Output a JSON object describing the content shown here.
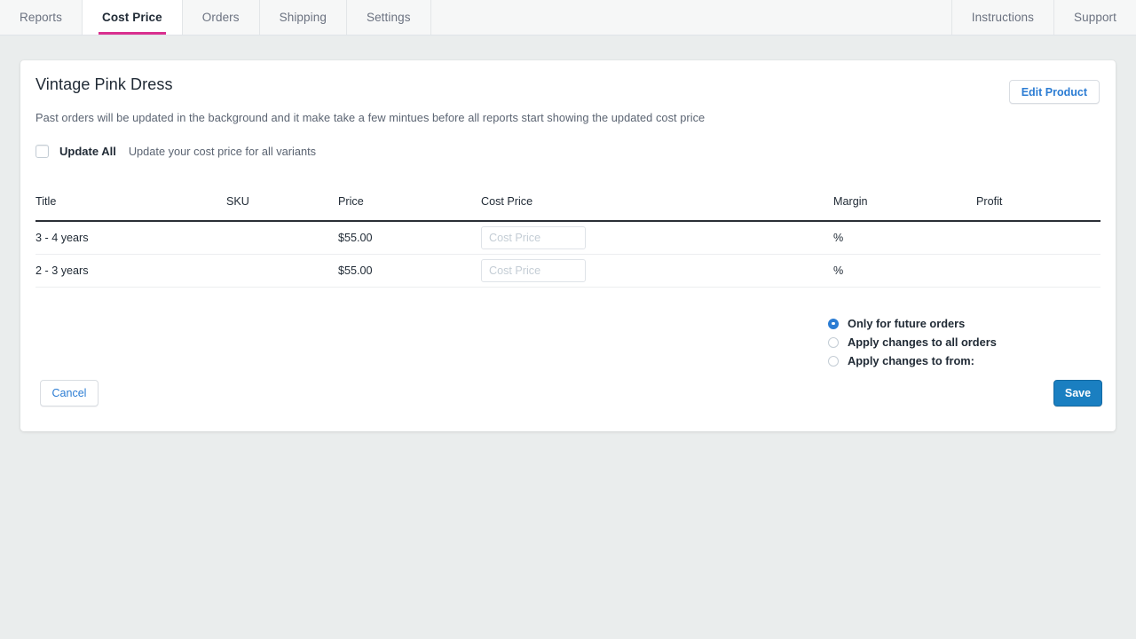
{
  "nav": {
    "left_tabs": [
      {
        "label": "Reports",
        "active": false
      },
      {
        "label": "Cost Price",
        "active": true
      },
      {
        "label": "Orders",
        "active": false
      },
      {
        "label": "Shipping",
        "active": false
      },
      {
        "label": "Settings",
        "active": false
      }
    ],
    "right_tabs": [
      {
        "label": "Instructions"
      },
      {
        "label": "Support"
      }
    ],
    "active_underline_color": "#d9308f"
  },
  "card": {
    "product_title": "Vintage Pink Dress",
    "edit_product_label": "Edit Product",
    "description": "Past orders will be updated in the background and it make take a few mintues before all reports start showing the updated cost price",
    "update_all": {
      "label": "Update All",
      "description": "Update your cost price for all variants",
      "checked": false
    },
    "table": {
      "columns": [
        "Title",
        "SKU",
        "Price",
        "Cost Price",
        "Margin",
        "Profit"
      ],
      "rows": [
        {
          "title": "3 - 4 years",
          "sku": "",
          "price": "$55.00",
          "cost_price_value": "",
          "cost_price_placeholder": "Cost Price",
          "margin": "%",
          "profit": ""
        },
        {
          "title": "2 - 3 years",
          "sku": "",
          "price": "$55.00",
          "cost_price_value": "",
          "cost_price_placeholder": "Cost Price",
          "margin": "%",
          "profit": ""
        }
      ]
    },
    "apply_options": [
      {
        "label": "Only for future orders",
        "selected": true
      },
      {
        "label": "Apply changes to all orders",
        "selected": false
      },
      {
        "label": "Apply changes to from:",
        "selected": false
      }
    ],
    "cancel_label": "Cancel",
    "save_label": "Save"
  },
  "colors": {
    "page_background": "#eaeded",
    "accent_pink": "#d9308f",
    "accent_blue": "#2b7cd3",
    "save_blue": "#1a7fc1"
  }
}
